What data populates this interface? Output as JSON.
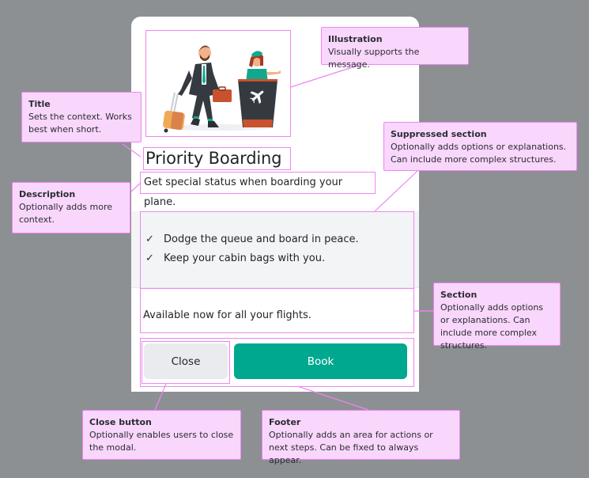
{
  "modal": {
    "illustration": {
      "icon": "traveler-at-boarding-desk-illustration",
      "plane_icon": "airplane-icon"
    },
    "title": "Priority Boarding",
    "description": "Get special status when boarding your plane.",
    "suppressed_section": {
      "items": [
        {
          "icon": "check-icon",
          "glyph": "✓",
          "text": "Dodge the queue and board in peace."
        },
        {
          "icon": "check-icon",
          "glyph": "✓",
          "text": "Keep your cabin bags with you."
        }
      ]
    },
    "section": {
      "text": "Available now for all your flights."
    },
    "footer": {
      "close_label": "Close",
      "book_label": "Book"
    }
  },
  "annotations": {
    "illustration": {
      "title": "Illustration",
      "body": "Visually supports the message."
    },
    "title": {
      "title": "Title",
      "body": "Sets the context. Works best when short."
    },
    "description": {
      "title": "Description",
      "body": "Optionally adds more context."
    },
    "suppressed_section": {
      "title": "Suppressed section",
      "body": "Optionally adds options or explanations. Can include more complex structures."
    },
    "section": {
      "title": "Section",
      "body": "Optionally adds options or explanations. Can include more complex structures."
    },
    "close_button": {
      "title": "Close button",
      "body": "Optionally enables users to close the modal."
    },
    "footer": {
      "title": "Footer",
      "body": "Optionally adds an area for actions or next steps. Can be fixed to always appear."
    }
  },
  "colors": {
    "backdrop": "#8d9093",
    "annotation_fill": "#f9d6fb",
    "annotation_stroke": "#ee85f3",
    "primary": "#00a88f",
    "secondary_button": "#e9ebee",
    "suppressed_bg": "#f3f4f6"
  }
}
